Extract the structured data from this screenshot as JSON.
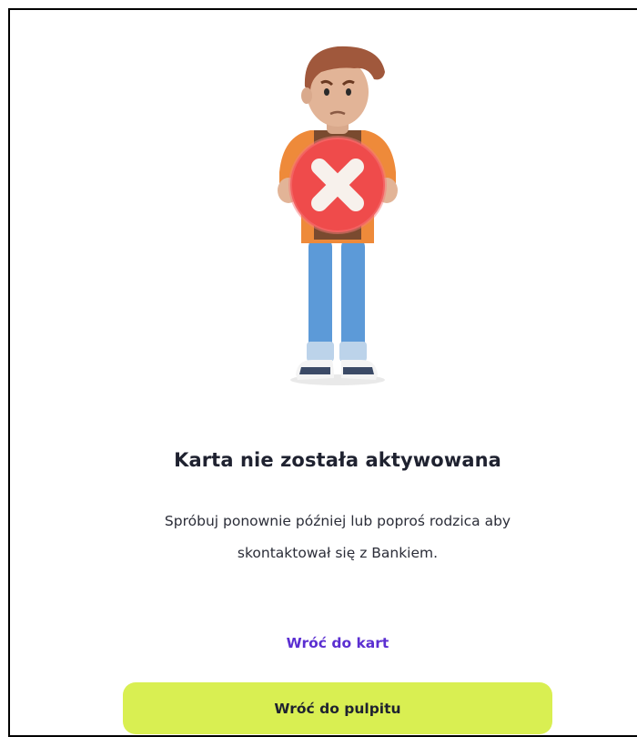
{
  "result": {
    "title": "Karta nie została aktywowana",
    "description": "Spróbuj ponownie później lub poproś rodzica aby skontaktował się z Bankiem."
  },
  "actions": {
    "back_to_cards": "Wróć do kart",
    "back_to_dashboard": "Wróć do pulpitu"
  },
  "colors": {
    "accent_link": "#5b2fd1",
    "primary_button": "#d9ef52",
    "error_badge": "#ef4b4b"
  },
  "illustration": {
    "icon": "cross-mark-icon"
  }
}
